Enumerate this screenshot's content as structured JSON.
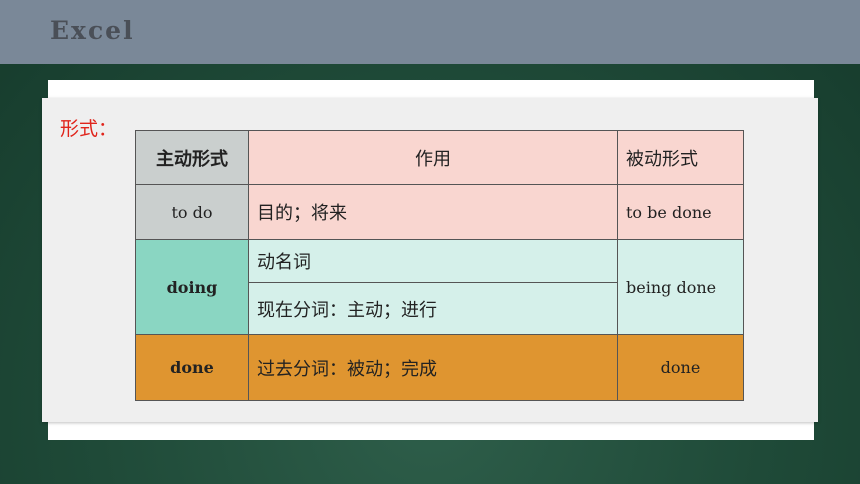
{
  "header": {
    "title": "Excel"
  },
  "form_label": "形式：",
  "table": {
    "headers": [
      "主动形式",
      "作用",
      "被动形式"
    ],
    "rows": {
      "todo": {
        "active": "to do",
        "uses": [
          "目的；将来"
        ],
        "passive": "to be done"
      },
      "doing": {
        "active": "doing",
        "uses": [
          "动名词",
          "现在分词：主动；进行"
        ],
        "passive": "being done"
      },
      "done": {
        "active": "done",
        "uses": [
          "过去分词：被动；完成"
        ],
        "passive": "done"
      }
    }
  },
  "colors": {
    "topbar": "#7a8898",
    "form_label": "#e0241b",
    "header_row": "#f9d6d0",
    "grey_cell": "#cacfce",
    "mint_cell": "#d5f0ea",
    "teal_cell": "#8ad6c2",
    "orange_row": "#df9530"
  }
}
